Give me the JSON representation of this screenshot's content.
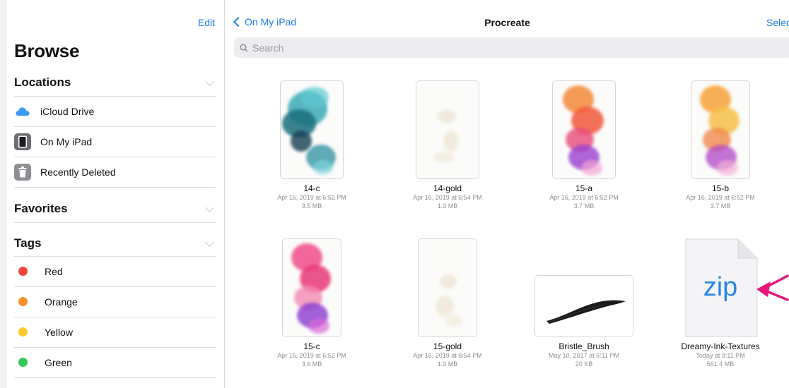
{
  "sidebar": {
    "edit_label": "Edit",
    "title": "Browse",
    "locations": {
      "header": "Locations",
      "items": [
        {
          "label": "iCloud Drive",
          "icon": "icloud-icon"
        },
        {
          "label": "On My iPad",
          "icon": "ipad-icon"
        },
        {
          "label": "Recently Deleted",
          "icon": "trash-icon"
        }
      ]
    },
    "favorites": {
      "header": "Favorites"
    },
    "tags": {
      "header": "Tags",
      "items": [
        {
          "label": "Red",
          "color": "#f2453d"
        },
        {
          "label": "Orange",
          "color": "#f7922a"
        },
        {
          "label": "Yellow",
          "color": "#fbc72c"
        },
        {
          "label": "Green",
          "color": "#34c759"
        }
      ]
    }
  },
  "main": {
    "back_label": "On My iPad",
    "title": "Procreate",
    "select_label": "Select",
    "search": {
      "placeholder": "Search"
    },
    "files": [
      {
        "name": "14-c",
        "date": "Apr 16, 2019 at 6:52 PM",
        "size": "3.5 MB",
        "thumb": "teal-ink"
      },
      {
        "name": "14-gold",
        "date": "Apr 16, 2019 at 6:54 PM",
        "size": "1.3 MB",
        "thumb": "gold-ink"
      },
      {
        "name": "15-a",
        "date": "Apr 16, 2019 at 6:52 PM",
        "size": "3.7 MB",
        "thumb": "orange-purple-ink"
      },
      {
        "name": "15-b",
        "date": "Apr 16, 2019 at 6:52 PM",
        "size": "3.7 MB",
        "thumb": "orange-yellow-ink"
      },
      {
        "name": "15-c",
        "date": "Apr 16, 2019 at 6:52 PM",
        "size": "3.6 MB",
        "thumb": "pink-purple-ink"
      },
      {
        "name": "15-gold",
        "date": "Apr 16, 2019 at 6:54 PM",
        "size": "1.3 MB",
        "thumb": "gold-ink"
      },
      {
        "name": "Bristle_Brush",
        "date": "May 10, 2017 at 5:11 PM",
        "size": "20 KB",
        "thumb": "brush-stroke"
      },
      {
        "name": "Dreamy-Ink-Textures",
        "date": "Today at 9:11 PM",
        "size": "561.4 MB",
        "thumb": "zip-file",
        "badge": "zip"
      }
    ]
  },
  "colors": {
    "accent": "#1a7cf5",
    "annotation_arrow": "#e8157c"
  }
}
